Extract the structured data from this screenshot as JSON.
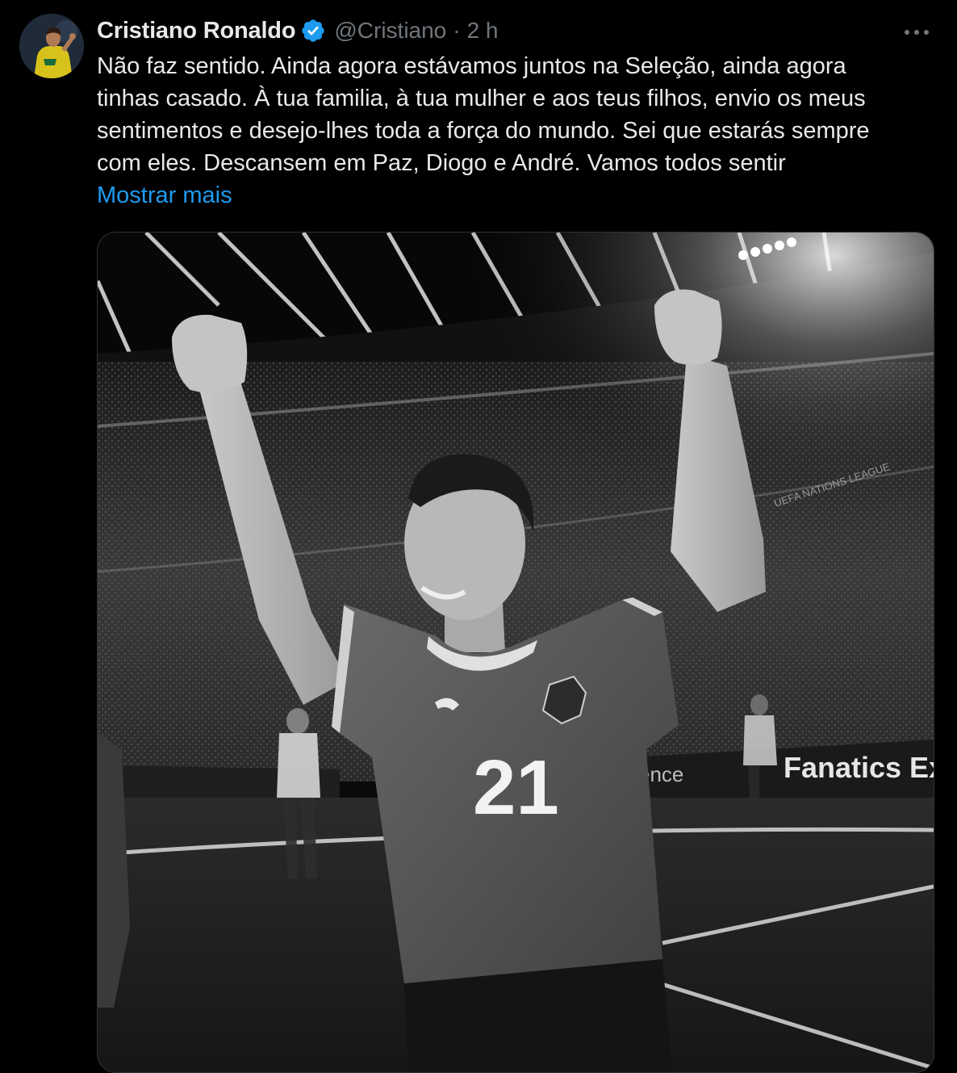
{
  "tweet": {
    "author_name": "Cristiano Ronaldo",
    "handle": "@Cristiano",
    "separator": "·",
    "time": "2 h",
    "text_lines": [
      "Não faz sentido. Ainda agora estávamos juntos na Seleção, ainda agora",
      "tinhas casado. À tua familia, à tua mulher e aos teus filhos, envio os meus",
      "sentimentos e desejo-lhes toda a força do mundo. Sei que estarás sempre",
      "com eles. Descansem em Paz, Diogo e André. Vamos todos sentir"
    ],
    "show_more": "Mostrar mais",
    "photo": {
      "jersey_number": "21",
      "board_text": "Fanatics Ex",
      "board_text_left": "ence",
      "banner_text": "UEFA NATIONS LEAGUE"
    }
  },
  "colors": {
    "background": "#000000",
    "text": "#e7e9ea",
    "secondary": "#71767b",
    "link": "#1d9bf0",
    "verified": "#1d9bf0",
    "border": "#2f3336"
  },
  "icons": {
    "verified": "verified-badge-icon",
    "more": "more-options-icon"
  }
}
